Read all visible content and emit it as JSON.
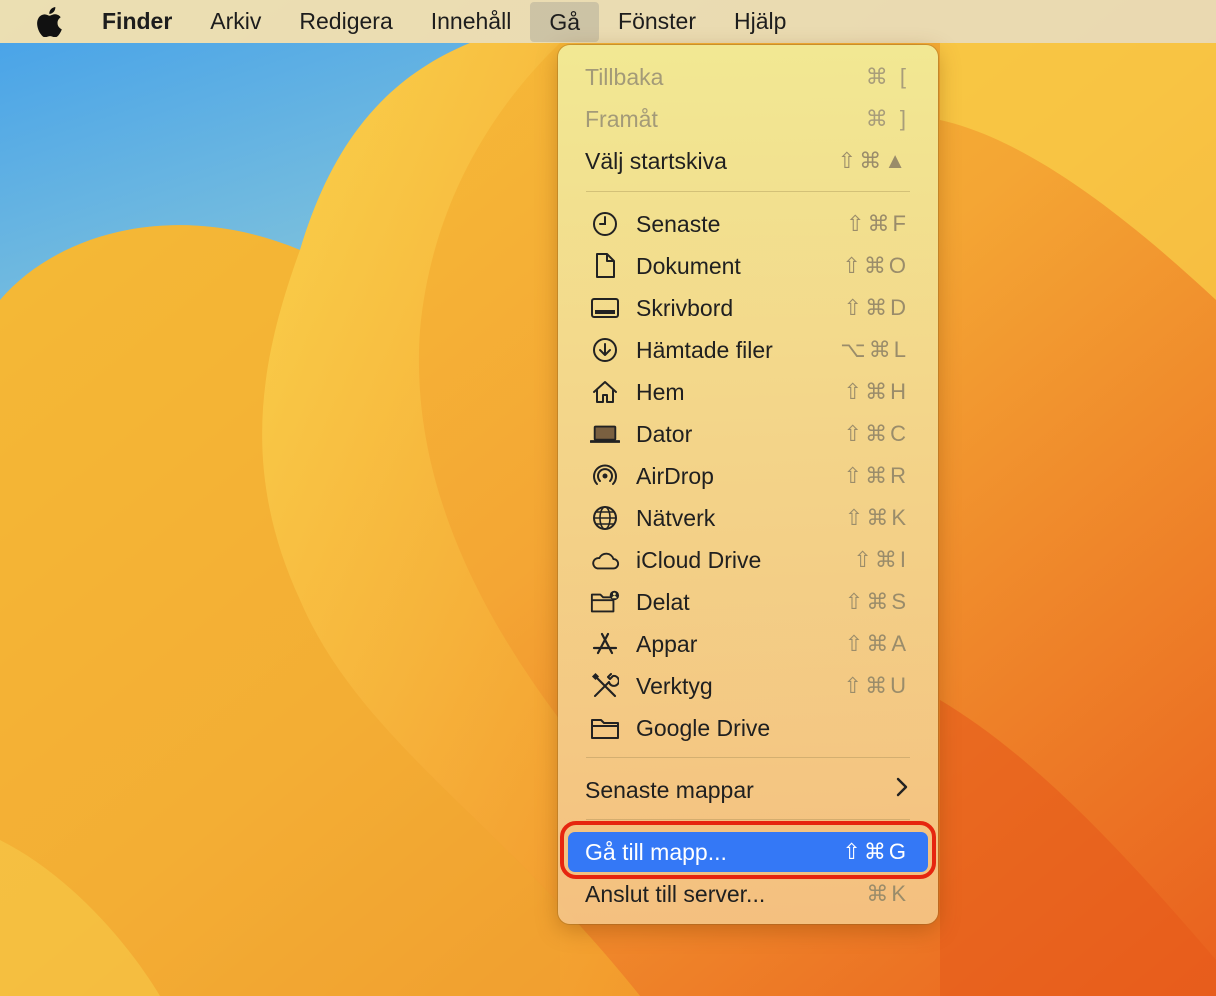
{
  "menubar": {
    "apple_icon": "apple-logo",
    "items": [
      "Finder",
      "Arkiv",
      "Redigera",
      "Innehåll",
      "Gå",
      "Fönster",
      "Hjälp"
    ],
    "active": "Gå"
  },
  "go_menu": {
    "top_items": [
      {
        "label": "Tillbaka",
        "shortcut": "⌘ [",
        "disabled": true
      },
      {
        "label": "Framåt",
        "shortcut": "⌘ ]",
        "disabled": true
      },
      {
        "label": "Välj startskiva",
        "shortcut": "⇧⌘▲",
        "disabled": false
      }
    ],
    "locations": [
      {
        "label": "Senaste",
        "shortcut": "⇧⌘F",
        "icon": "clock-icon"
      },
      {
        "label": "Dokument",
        "shortcut": "⇧⌘O",
        "icon": "document-icon"
      },
      {
        "label": "Skrivbord",
        "shortcut": "⇧⌘D",
        "icon": "desktop-icon"
      },
      {
        "label": "Hämtade filer",
        "shortcut": "⌥⌘L",
        "icon": "download-icon"
      },
      {
        "label": "Hem",
        "shortcut": "⇧⌘H",
        "icon": "home-icon"
      },
      {
        "label": "Dator",
        "shortcut": "⇧⌘C",
        "icon": "laptop-icon"
      },
      {
        "label": "AirDrop",
        "shortcut": "⇧⌘R",
        "icon": "airdrop-icon"
      },
      {
        "label": "Nätverk",
        "shortcut": "⇧⌘K",
        "icon": "globe-icon"
      },
      {
        "label": "iCloud Drive",
        "shortcut": "⇧⌘I",
        "icon": "cloud-icon"
      },
      {
        "label": "Delat",
        "shortcut": "⇧⌘S",
        "icon": "shared-folder-icon"
      },
      {
        "label": "Appar",
        "shortcut": "⇧⌘A",
        "icon": "apps-icon"
      },
      {
        "label": "Verktyg",
        "shortcut": "⇧⌘U",
        "icon": "tools-icon"
      },
      {
        "label": "Google Drive",
        "shortcut": "",
        "icon": "folder-icon"
      }
    ],
    "recent_folders": {
      "label": "Senaste mappar",
      "icon": "chevron-right-icon"
    },
    "goto_folder": {
      "label": "Gå till mapp...",
      "shortcut": "⇧⌘G",
      "selected": true
    },
    "connect_server": {
      "label": "Anslut till server...",
      "shortcut": "⌘K"
    }
  },
  "colors": {
    "selection": "#3478f6",
    "highlight_ring": "#e6260f"
  }
}
